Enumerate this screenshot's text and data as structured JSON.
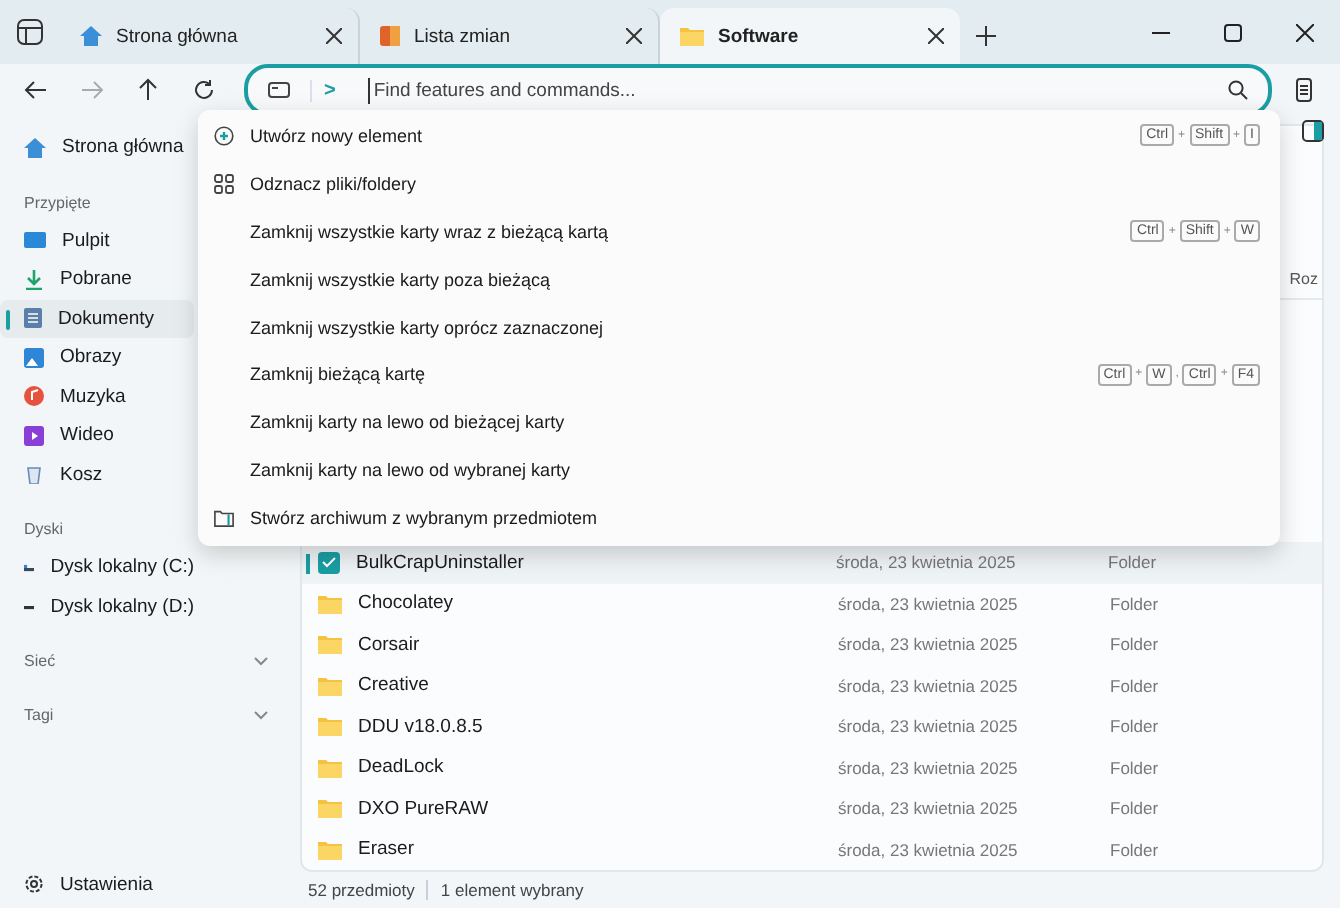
{
  "tabs": [
    {
      "label": "Strona główna",
      "selected": false
    },
    {
      "label": "Lista zmian",
      "selected": false
    },
    {
      "label": "Software",
      "selected": true
    }
  ],
  "omnibar": {
    "mode": ">",
    "placeholder": "Find features and commands..."
  },
  "sidebar": {
    "home": "Strona główna",
    "sections": [
      {
        "title": "Przypięte",
        "items": [
          {
            "label": "Pulpit",
            "selected": false
          },
          {
            "label": "Pobrane",
            "selected": false
          },
          {
            "label": "Dokumenty",
            "selected": true
          },
          {
            "label": "Obrazy",
            "selected": false
          },
          {
            "label": "Muzyka",
            "selected": false
          },
          {
            "label": "Wideo",
            "selected": false
          },
          {
            "label": "Kosz",
            "selected": false
          }
        ]
      },
      {
        "title": "Dyski",
        "items": [
          {
            "label": "Dysk lokalny (C:)",
            "selected": false
          },
          {
            "label": "Dysk lokalny (D:)",
            "selected": false
          }
        ]
      },
      {
        "title": "Sieć",
        "expanded": false
      },
      {
        "title": "Tagi",
        "expanded": false
      }
    ],
    "settings": "Ustawienia"
  },
  "column_header": "Roz",
  "commands": [
    {
      "label": "Utwórz nowy element",
      "kind": "plus",
      "shortcut": [
        {
          "key": "Ctrl"
        },
        {
          "sep": "+"
        },
        {
          "key": "Shift"
        },
        {
          "sep": "+"
        },
        {
          "key": "I"
        }
      ]
    },
    {
      "label": "Odznacz pliki/foldery",
      "kind": "grid"
    },
    {
      "label": "Zamknij wszystkie karty wraz z bieżącą kartą",
      "kind": "plain",
      "shortcut": [
        {
          "key": "Ctrl"
        },
        {
          "sep": "+"
        },
        {
          "key": "Shift"
        },
        {
          "sep": "+"
        },
        {
          "key": "W"
        }
      ]
    },
    {
      "label": "Zamknij wszystkie karty poza bieżącą",
      "kind": "plain"
    },
    {
      "label": "Zamknij wszystkie karty oprócz zaznaczonej",
      "kind": "plain"
    },
    {
      "label": "Zamknij bieżącą kartę",
      "kind": "plain",
      "shortcut": [
        {
          "key": "Ctrl"
        },
        {
          "sep": "+"
        },
        {
          "key": "W"
        },
        {
          "sep": ","
        },
        {
          "key": "Ctrl"
        },
        {
          "sep": "+"
        },
        {
          "key": "F4"
        }
      ]
    },
    {
      "label": "Zamknij karty na lewo od bieżącej karty",
      "kind": "plain"
    },
    {
      "label": "Zamknij karty na lewo od wybranej karty",
      "kind": "plain"
    },
    {
      "label": "Stwórz archiwum z wybranym przedmiotem",
      "kind": "archive"
    }
  ],
  "files": [
    {
      "name": "BulkCrapUninstaller",
      "date": "środa, 23 kwietnia 2025",
      "type": "Folder",
      "selected": true
    },
    {
      "name": "Chocolatey",
      "date": "środa, 23 kwietnia 2025",
      "type": "Folder",
      "selected": false
    },
    {
      "name": "Corsair",
      "date": "środa, 23 kwietnia 2025",
      "type": "Folder",
      "selected": false
    },
    {
      "name": "Creative",
      "date": "środa, 23 kwietnia 2025",
      "type": "Folder",
      "selected": false
    },
    {
      "name": "DDU v18.0.8.5",
      "date": "środa, 23 kwietnia 2025",
      "type": "Folder",
      "selected": false
    },
    {
      "name": "DeadLock",
      "date": "środa, 23 kwietnia 2025",
      "type": "Folder",
      "selected": false
    },
    {
      "name": "DXO PureRAW",
      "date": "środa, 23 kwietnia 2025",
      "type": "Folder",
      "selected": false
    },
    {
      "name": "Eraser",
      "date": "środa, 23 kwietnia 2025",
      "type": "Folder",
      "selected": false
    }
  ],
  "status_bar": {
    "count": "52 przedmioty",
    "selection": "1 element wybrany"
  }
}
